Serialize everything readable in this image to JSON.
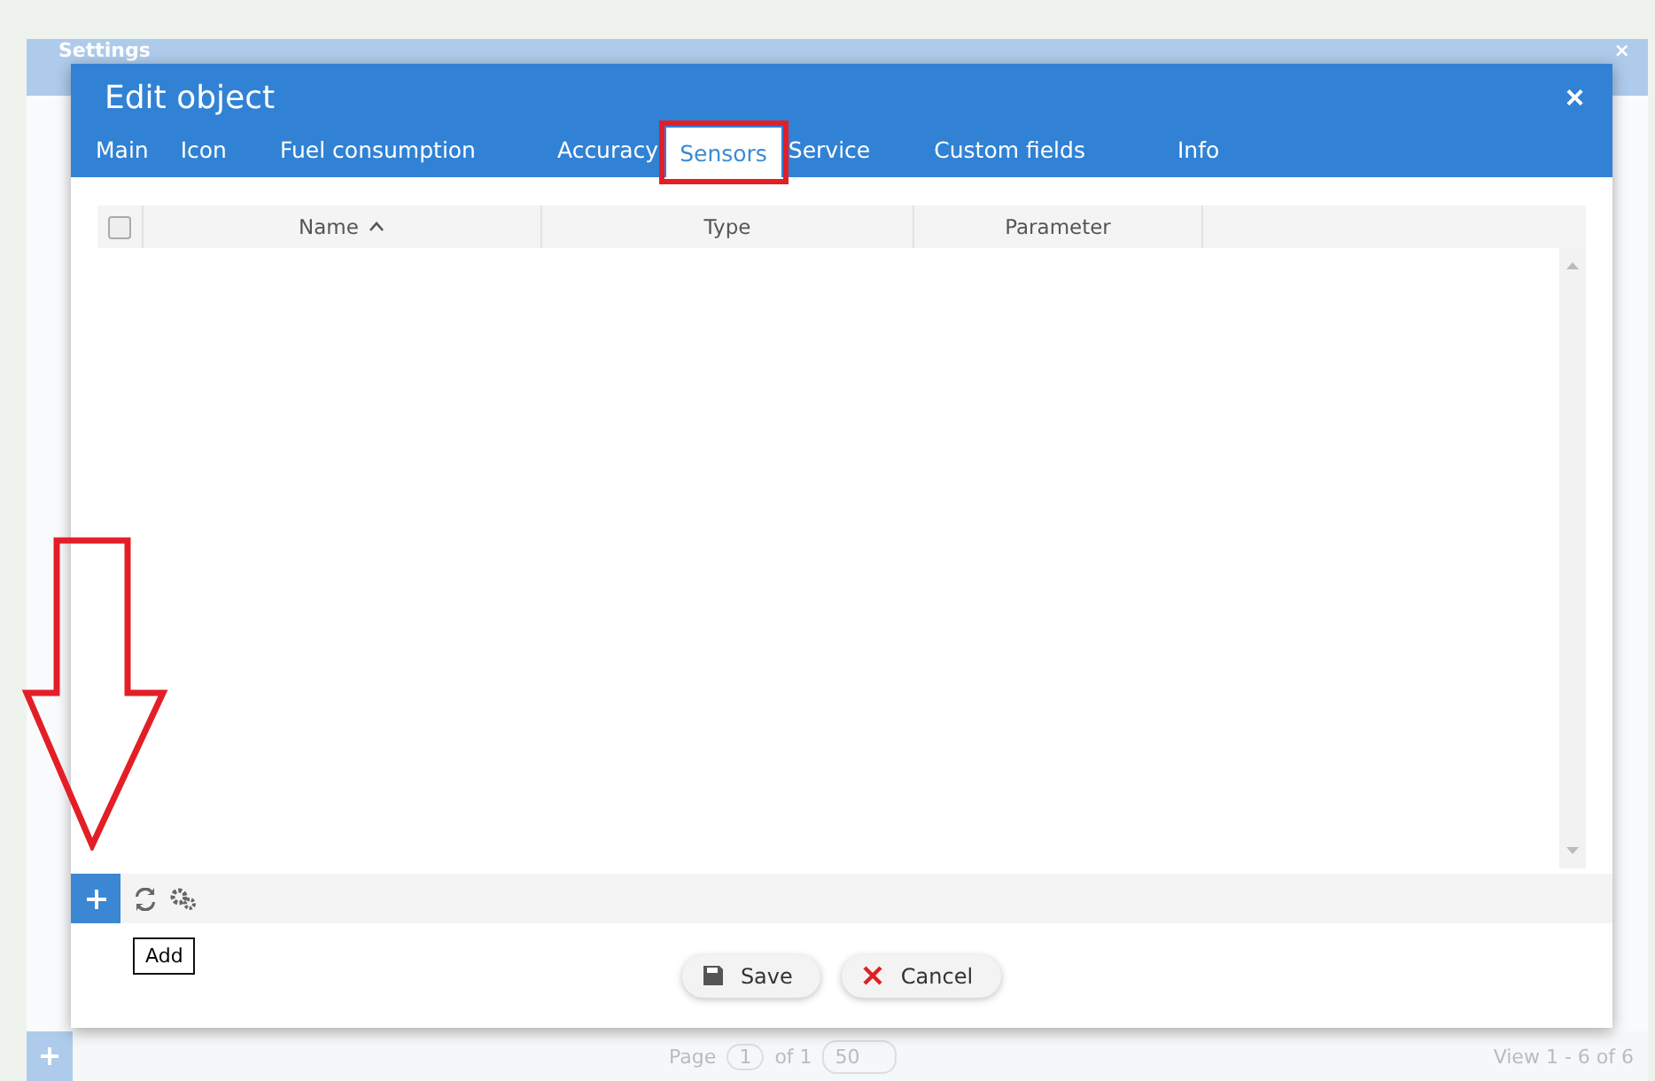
{
  "settings_window": {
    "title": "Settings",
    "close": "×",
    "pager": {
      "page_label": "Page",
      "page": "1",
      "of": "of 1",
      "page_size": "50",
      "summary": "View 1 - 6 of 6"
    }
  },
  "dialog": {
    "title": "Edit object",
    "close": "×",
    "tabs": [
      {
        "label": "Main",
        "selected": false,
        "highlighted": false
      },
      {
        "label": "Icon",
        "selected": false,
        "highlighted": false
      },
      {
        "label": "Fuel consumption",
        "selected": false,
        "highlighted": false
      },
      {
        "label": "Accuracy",
        "selected": false,
        "highlighted": false
      },
      {
        "label": "Sensors",
        "selected": true,
        "highlighted": true
      },
      {
        "label": "Service",
        "selected": false,
        "highlighted": false
      },
      {
        "label": "Custom fields",
        "selected": false,
        "highlighted": false
      },
      {
        "label": "Info",
        "selected": false,
        "highlighted": false
      }
    ],
    "table": {
      "select_all_checked": false,
      "columns": [
        {
          "label": "Name",
          "sorted": true
        },
        {
          "label": "Type",
          "sorted": false
        },
        {
          "label": "Parameter",
          "sorted": false
        }
      ]
    },
    "tooltip": "Add",
    "buttons": [
      {
        "kind": "save",
        "label": "Save"
      },
      {
        "kind": "cancel",
        "label": "Cancel"
      }
    ]
  },
  "annotation_arrow": true
}
